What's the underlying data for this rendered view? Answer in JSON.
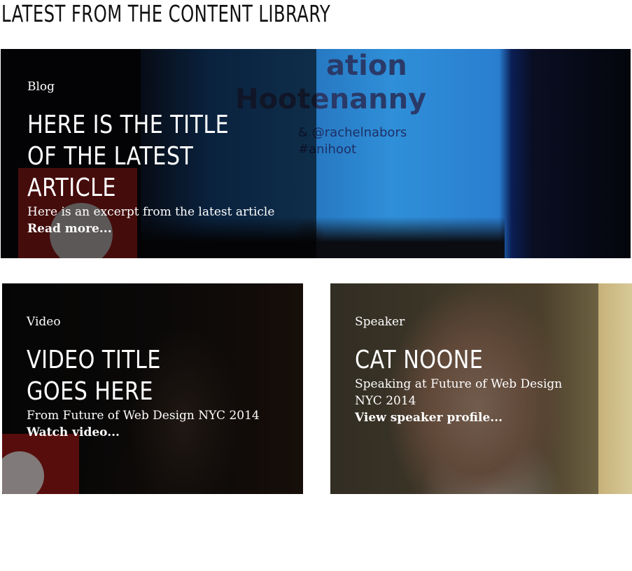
{
  "section": {
    "heading": "LATEST FROM THE CONTENT LIBRARY"
  },
  "cards": [
    {
      "category": "Blog",
      "title": "HERE IS THE TITLE OF THE LATEST ARTICLE",
      "excerpt": "Here is an excerpt from the latest article",
      "link": "Read more...",
      "image_text": {
        "line1": "ation",
        "line2": "Hootenanny",
        "handle": "& @rachelnabors",
        "hashtag": "#anihoot"
      }
    },
    {
      "category": "Video",
      "title": "VIDEO TITLE GOES HERE",
      "excerpt": "From Future of Web Design NYC 2014",
      "link": "Watch video..."
    },
    {
      "category": "Speaker",
      "title": "CAT NOONE",
      "excerpt": "Speaking at  Future of Web Design NYC 2014",
      "link": "View speaker profile..."
    }
  ],
  "colors": {
    "overlay": "#000000",
    "text": "#ffffff",
    "heading": "#111111"
  }
}
